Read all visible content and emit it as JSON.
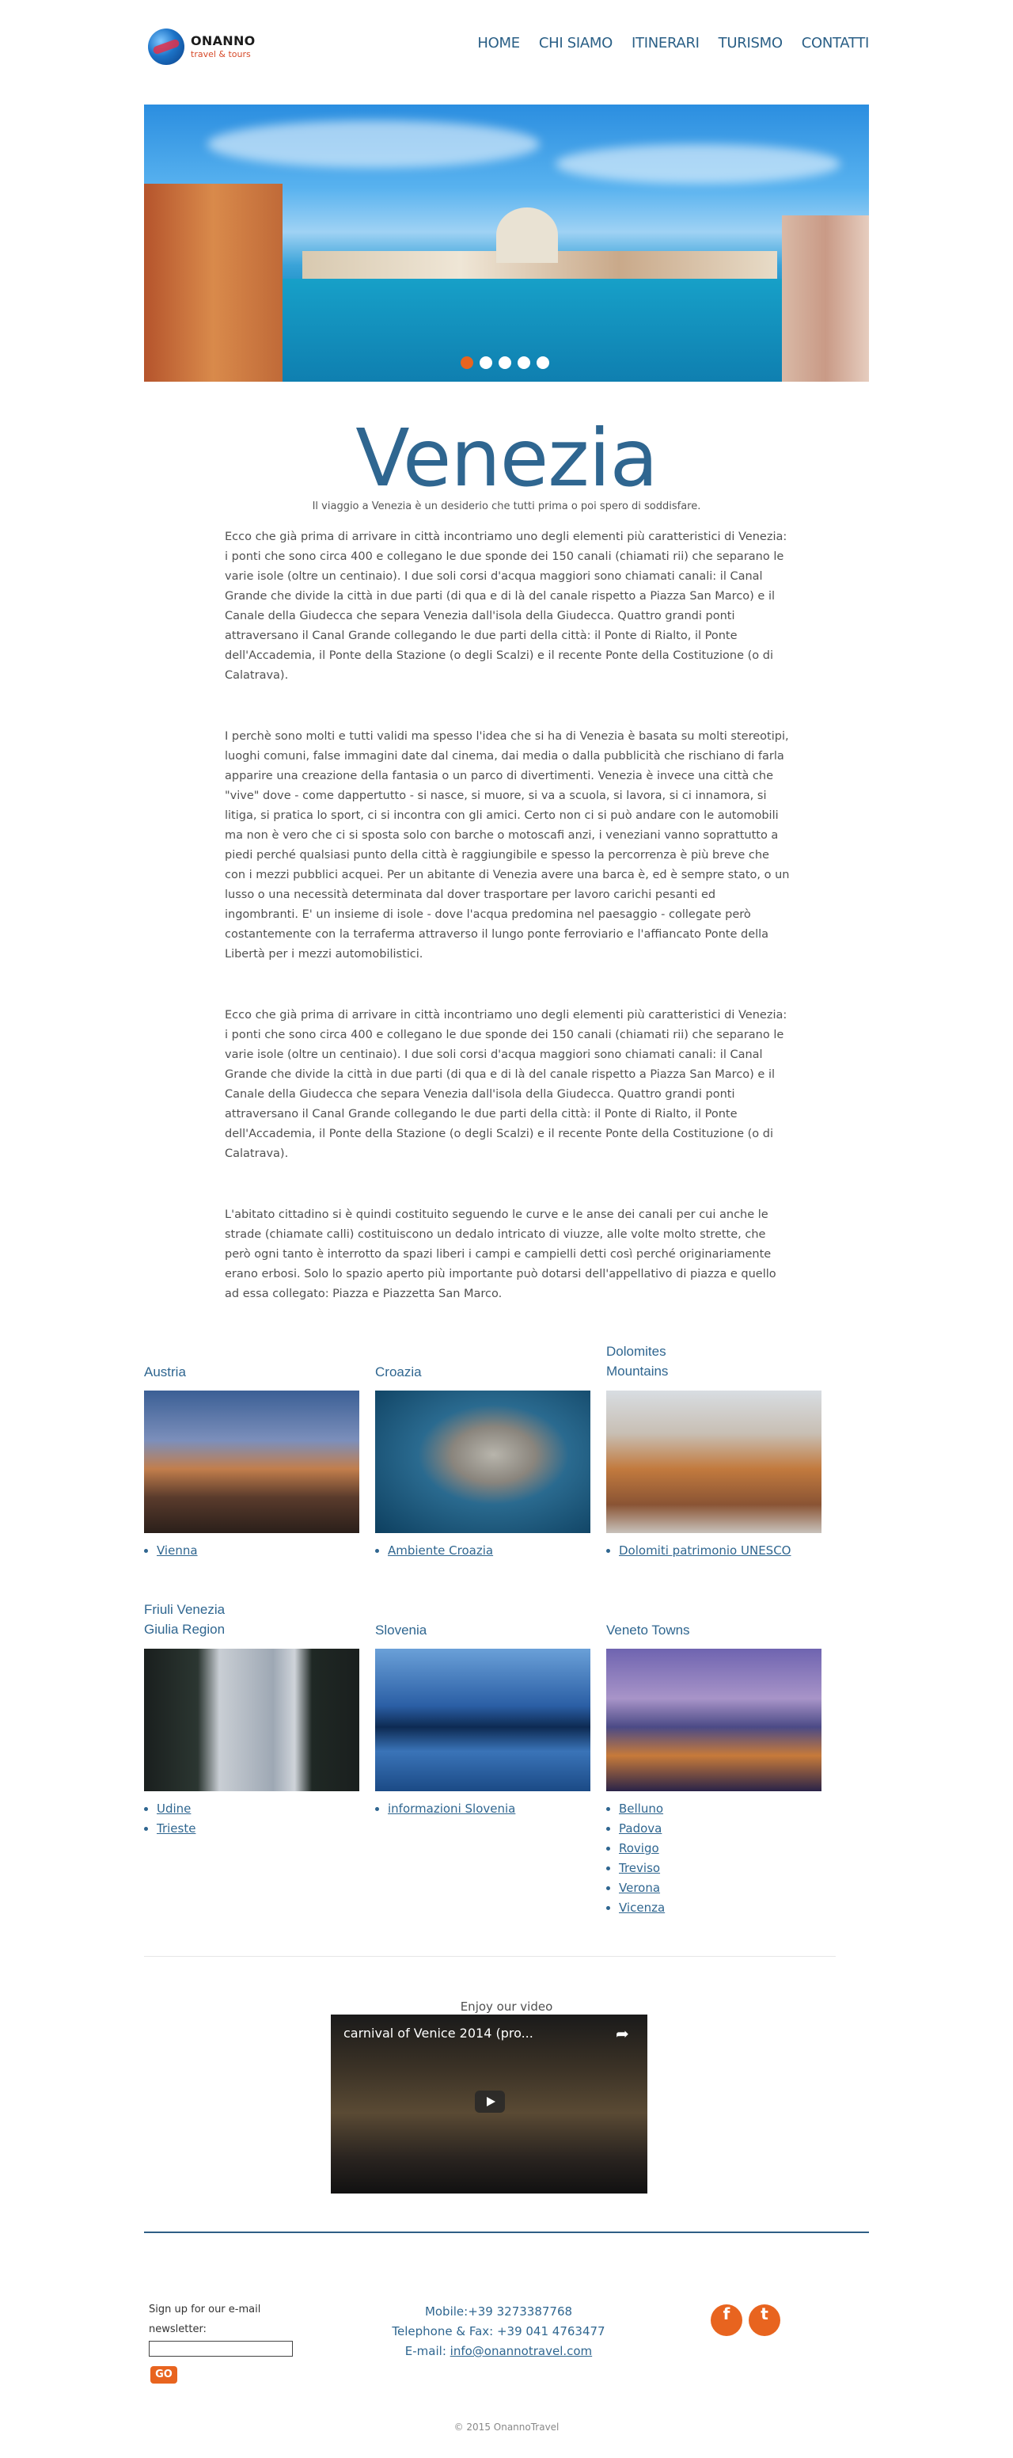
{
  "header": {
    "logo_name": "ONANNO",
    "logo_tag": "travel & tours",
    "nav": [
      "HOME",
      "CHI SIAMO",
      "ITINERARI",
      "TURISMO",
      "CONTATTI"
    ]
  },
  "hero": {
    "slides_count": 5,
    "active_slide": 1
  },
  "page": {
    "title": "Venezia",
    "subtitle": "Il viaggio a Venezia è un desiderio che tutti prima o poi spero di soddisfare.",
    "paragraphs": [
      "Ecco che già prima di arrivare in città incontriamo uno degli elementi più caratteristici di Venezia: i ponti che sono circa 400 e collegano le due sponde dei 150 canali (chiamati rii) che separano le varie isole (oltre un centinaio). I due soli corsi d'acqua maggiori sono chiamati canali: il Canal Grande che divide la città in due parti (di qua e di là del canale rispetto a Piazza San Marco) e il Canale della Giudecca che separa Venezia dall'isola della Giudecca. Quattro grandi ponti attraversano il Canal Grande collegando le due parti della città: il Ponte di Rialto, il Ponte dell'Accademia, il Ponte della Stazione (o degli Scalzi) e il recente Ponte della Costituzione (o di Calatrava).",
      "I perchè sono molti e tutti validi ma spesso l'idea che si ha di Venezia è basata su molti stereotipi, luoghi comuni, false immagini date dal cinema, dai media o dalla pubblicità che rischiano di farla apparire una creazione della fantasia o un parco di divertimenti. Venezia è invece una città che \"vive\" dove - come dappertutto - si nasce, si muore, si va a scuola, si lavora, si ci innamora, si litiga, si pratica lo sport, ci si incontra con gli amici.  Certo non ci si può andare con le automobili ma non è vero che ci si sposta solo con barche o motoscafi anzi, i veneziani vanno soprattutto a piedi perché qualsiasi punto della città è raggiungibile e spesso la percorrenza è più breve che con i mezzi pubblici acquei. Per un abitante di Venezia avere una barca è, ed è sempre stato, o un lusso o una necessità determinata dal dover trasportare per lavoro carichi pesanti ed ingombranti. E' un insieme di isole - dove l'acqua predomina nel paesaggio - collegate però costantemente con la terraferma attraverso il lungo ponte ferroviario e l'affiancato Ponte della Libertà per i mezzi automobilistici.",
      "Ecco che già prima di arrivare in città incontriamo uno degli elementi più caratteristici di Venezia: i ponti che sono circa 400 e collegano le due sponde dei 150 canali (chiamati rii) che separano le varie isole (oltre un centinaio). I due soli corsi d'acqua maggiori sono chiamati canali: il Canal Grande che divide la città in due parti (di qua e di là del canale rispetto a Piazza San Marco) e il Canale della Giudecca che separa Venezia dall'isola della Giudecca. Quattro grandi ponti attraversano il Canal Grande collegando le due parti della città: il Ponte di Rialto, il Ponte dell'Accademia, il Ponte della Stazione (o degli Scalzi) e il recente Ponte della Costituzione (o di Calatrava).",
      "L'abitato cittadino si è quindi costituito seguendo le curve e le anse dei canali per cui anche le strade (chiamate calli) costituiscono un dedalo intricato di viuzze, alle volte molto strette, che però ogni tanto è interrotto da spazi liberi i campi e campielli detti così perché originariamente erano erbosi. Solo lo spazio aperto più importante può dotarsi dell'appellativo di piazza e quello ad essa collegato: Piazza e Piazzetta San Marco."
    ]
  },
  "regions": [
    {
      "title": "Austria",
      "links": [
        "Vienna"
      ]
    },
    {
      "title": "Croazia",
      "links": [
        "Ambiente Croazia"
      ]
    },
    {
      "title": "Dolomites Mountains",
      "links": [
        "Dolomiti patrimonio UNESCO"
      ]
    },
    {
      "title": "Friuli Venezia Giulia Region",
      "links": [
        "Udine",
        "Trieste"
      ]
    },
    {
      "title": "Slovenia",
      "links": [
        "informazioni Slovenia"
      ]
    },
    {
      "title": "Veneto Towns",
      "links": [
        "Belluno",
        "Padova",
        "Rovigo",
        "Treviso",
        "Verona",
        "Vicenza"
      ]
    }
  ],
  "video": {
    "label": "Enjoy our video",
    "title": "carnival of Venice 2014 (pro..."
  },
  "footer": {
    "signup_label": "Sign up for our e-mail newsletter:",
    "signup_value": "",
    "go_label": "GO",
    "mobile": "Mobile:+39 3273387768",
    "phone": "Telephone & Fax: +39 041 4763477",
    "email_prefix": "E-mail: ",
    "email": "info@onannotravel.com",
    "social": [
      "f",
      "t"
    ],
    "copyright": "© 2015 OnannoTravel"
  }
}
